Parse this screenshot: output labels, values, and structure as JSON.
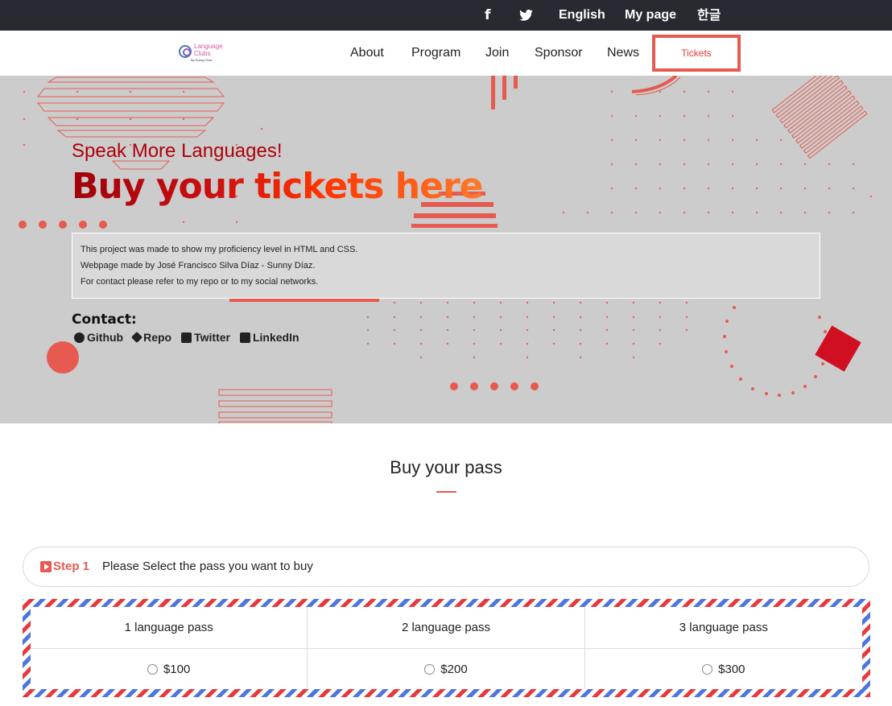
{
  "topbar": {
    "facebook_icon": "f",
    "twitter_icon": "🐦",
    "english": "English",
    "mypage": "My page",
    "korean": "한글"
  },
  "logo": {
    "name": "Language\nClubs",
    "by": "By Sunny Díaz"
  },
  "nav": {
    "items": [
      "About",
      "Program",
      "Join",
      "Sponsor",
      "News"
    ],
    "tickets": "Tickets"
  },
  "hero": {
    "subtitle": "Speak More Languages!",
    "headline": "Buy your tickets here",
    "info_lines": [
      "This project was made to show my proficiency level in HTML and CSS.",
      "Webpage made by José Francisco Silva Díaz - Sunny Díaz.",
      "For contact please refer to my repo or to my social networks."
    ],
    "contact_title": "Contact:",
    "contact_links": [
      "Github",
      "Repo",
      "Twitter",
      "LinkedIn"
    ]
  },
  "section": {
    "title": "Buy your pass"
  },
  "step": {
    "label": "Step 1",
    "text": "Please Select the pass you want to buy"
  },
  "passes": [
    {
      "name": "1 language pass",
      "price": "$100"
    },
    {
      "name": "2 language pass",
      "price": "$200"
    },
    {
      "name": "3 language pass",
      "price": "$300"
    }
  ],
  "colors": {
    "accent": "#e65a4f",
    "topbar": "#272a31",
    "hero_bg": "#cccccc"
  }
}
